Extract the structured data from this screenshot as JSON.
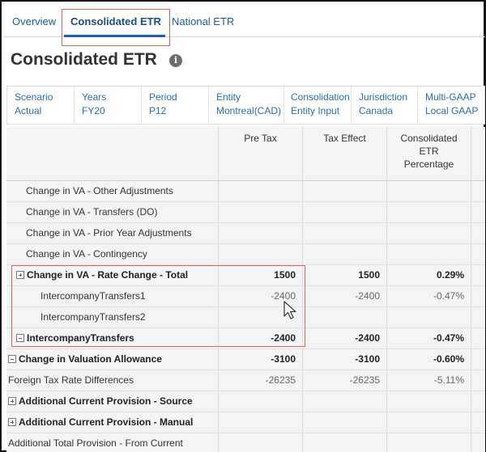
{
  "tabs": [
    {
      "label": "Overview",
      "active": false
    },
    {
      "label": "Consolidated ETR",
      "active": true
    },
    {
      "label": "National ETR",
      "active": false
    }
  ],
  "page": {
    "title": "Consolidated ETR",
    "info_icon": "info-icon"
  },
  "pov": [
    {
      "dimension": "Scenario",
      "value": "Actual"
    },
    {
      "dimension": "Years",
      "value": "FY20"
    },
    {
      "dimension": "Period",
      "value": "P12"
    },
    {
      "dimension": "Entity",
      "value": "Montreal(CAD)"
    },
    {
      "dimension": "Consolidation",
      "value": "Entity Input"
    },
    {
      "dimension": "Jurisdiction",
      "value": "Canada"
    },
    {
      "dimension": "Multi-GAAP",
      "value": "Local GAAP"
    }
  ],
  "grid": {
    "columns": [
      "Pre Tax",
      "Tax Effect",
      "Consolidated ETR Percentage"
    ],
    "column_lines": {
      "pre_tax": [
        "Pre Tax"
      ],
      "tax_effect": [
        "Tax Effect"
      ],
      "etr": [
        "Consolidated",
        "ETR",
        "Percentage"
      ]
    },
    "rows": [
      {
        "label": "Change in VA - Other Adjustments",
        "pre_tax": "",
        "tax_effect": "",
        "etr": "",
        "bold": false,
        "expander": null
      },
      {
        "label": "Change in VA - Transfers (DO)",
        "pre_tax": "",
        "tax_effect": "",
        "etr": "",
        "bold": false,
        "expander": null
      },
      {
        "label": "Change in VA - Prior Year Adjustments",
        "pre_tax": "",
        "tax_effect": "",
        "etr": "",
        "bold": false,
        "expander": null
      },
      {
        "label": "Change in VA - Contingency",
        "pre_tax": "",
        "tax_effect": "",
        "etr": "",
        "bold": false,
        "expander": null
      },
      {
        "label": "Change in VA - Rate Change - Total",
        "pre_tax": "1500",
        "tax_effect": "1500",
        "etr": "0.29%",
        "bold": true,
        "expander": "expand"
      },
      {
        "label": "IntercompanyTransfers1",
        "pre_tax": "-2400",
        "tax_effect": "-2400",
        "etr": "-0.47%",
        "bold": false,
        "expander": null
      },
      {
        "label": "IntercompanyTransfers2",
        "pre_tax": "",
        "tax_effect": "",
        "etr": "",
        "bold": false,
        "expander": null
      },
      {
        "label": "IntercompanyTransfers",
        "pre_tax": "-2400",
        "tax_effect": "-2400",
        "etr": "-0.47%",
        "bold": true,
        "expander": "collapse"
      },
      {
        "label": "Change in Valuation Allowance",
        "pre_tax": "-3100",
        "tax_effect": "-3100",
        "etr": "-0.60%",
        "bold": true,
        "expander": "collapse"
      },
      {
        "label": "Foreign Tax Rate Differences",
        "pre_tax": "-26235",
        "tax_effect": "-26235",
        "etr": "-5.11%",
        "bold": false,
        "expander": null
      },
      {
        "label": "Additional Current Provision - Source",
        "pre_tax": "",
        "tax_effect": "",
        "etr": "",
        "bold": true,
        "expander": "expand"
      },
      {
        "label": "Additional Current Provision - Manual",
        "pre_tax": "",
        "tax_effect": "",
        "etr": "",
        "bold": true,
        "expander": "expand"
      },
      {
        "label": "Additional Total Provision - From Current",
        "pre_tax": "",
        "tax_effect": "",
        "etr": "",
        "bold": false,
        "expander": null
      }
    ]
  },
  "colors": {
    "accent": "#1f5fb0",
    "link": "#2d6ca8",
    "highlight": "#e0605a",
    "grid_bg": "#f3f4f5"
  }
}
